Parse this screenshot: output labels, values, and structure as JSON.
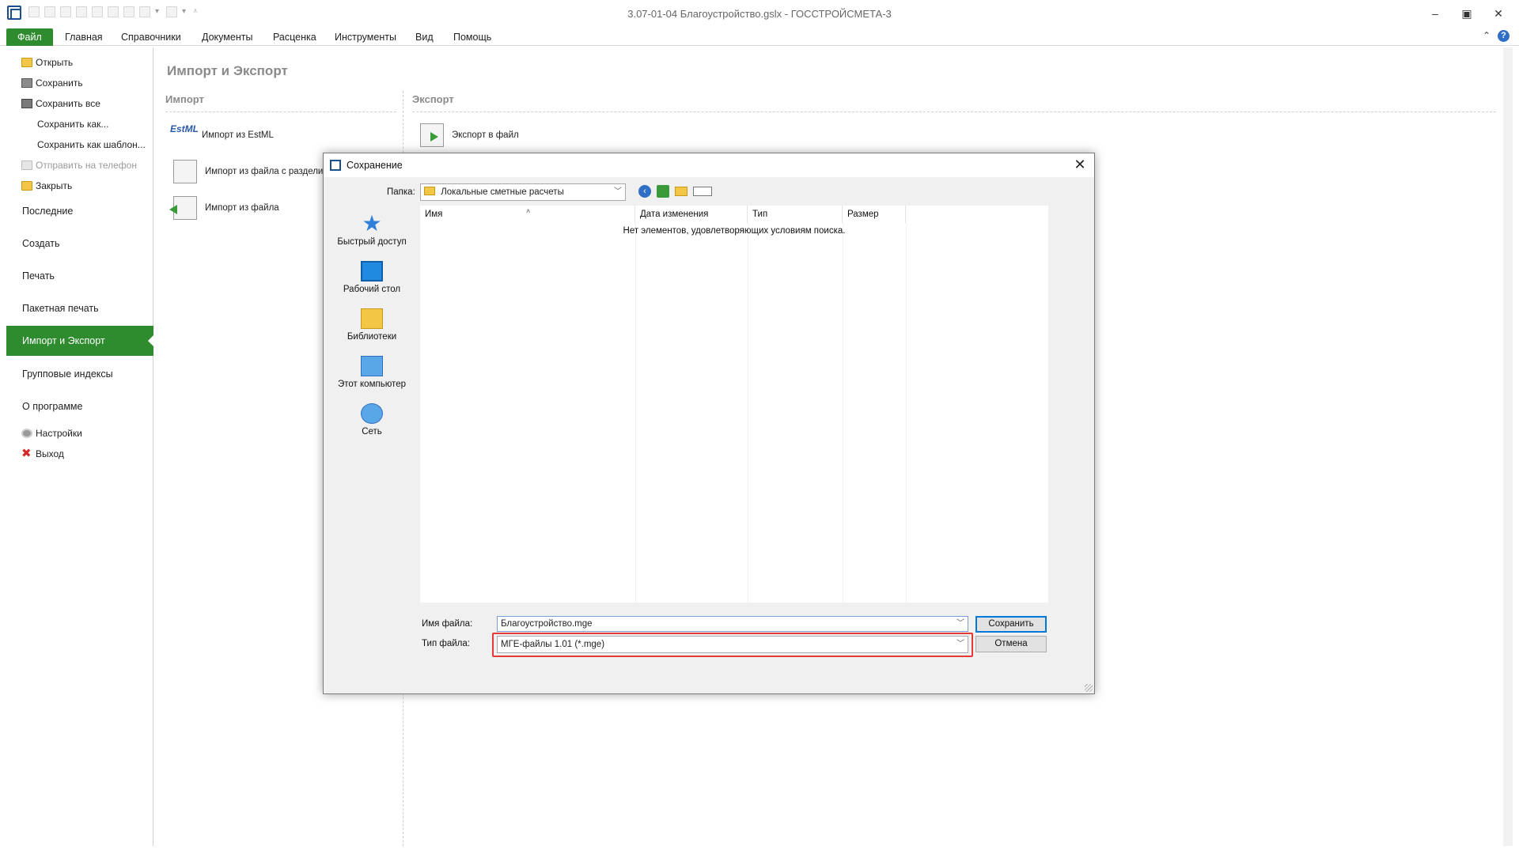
{
  "titlebar": {
    "title": "3.07-01-04  Благоустройство.gslx - ГОССТРОЙСМЕТА-3"
  },
  "ribbon": {
    "tabs": [
      "Файл",
      "Главная",
      "Справочники",
      "Документы",
      "Расценка",
      "Инструменты",
      "Вид",
      "Помощь"
    ]
  },
  "backstage": {
    "open": "Открыть",
    "save": "Сохранить",
    "save_all": "Сохранить все",
    "save_as": "Сохранить как...",
    "save_as_template": "Сохранить как шаблон...",
    "send_to_phone": "Отправить на телефон",
    "close": "Закрыть",
    "recent": "Последние",
    "create": "Создать",
    "print": "Печать",
    "batch_print": "Пакетная печать",
    "import_export": "Импорт и Экспорт",
    "group_indexes": "Групповые индексы",
    "about": "О программе",
    "settings": "Настройки",
    "exit": "Выход"
  },
  "content": {
    "page_title": "Импорт и Экспорт",
    "import_title": "Импорт",
    "export_title": "Экспорт",
    "import_estml": "Импорт из EstML",
    "import_delimited": "Импорт из файла с разделите",
    "import_file": "Импорт из файла",
    "export_file": "Экспорт в файл",
    "estml_icon_text": "EstML"
  },
  "dialog": {
    "title": "Сохранение",
    "folder_label": "Папка:",
    "folder_value": "Локальные сметные расчеты",
    "places": [
      "Быстрый доступ",
      "Рабочий стол",
      "Библиотеки",
      "Этот компьютер",
      "Сеть"
    ],
    "columns": [
      "Имя",
      "Дата изменения",
      "Тип",
      "Размер"
    ],
    "empty_message": "Нет элементов, удовлетворяющих условиям поиска.",
    "filename_label": "Имя файла:",
    "filename_value": "Благоустройство.mge",
    "filetype_label": "Тип файла:",
    "filetype_value": "МГЕ-файлы 1.01 (*.mge)",
    "save_button": "Сохранить",
    "cancel_button": "Отмена"
  },
  "colors": {
    "accent_green": "#2e8b2e",
    "highlight_red": "#e53935"
  }
}
